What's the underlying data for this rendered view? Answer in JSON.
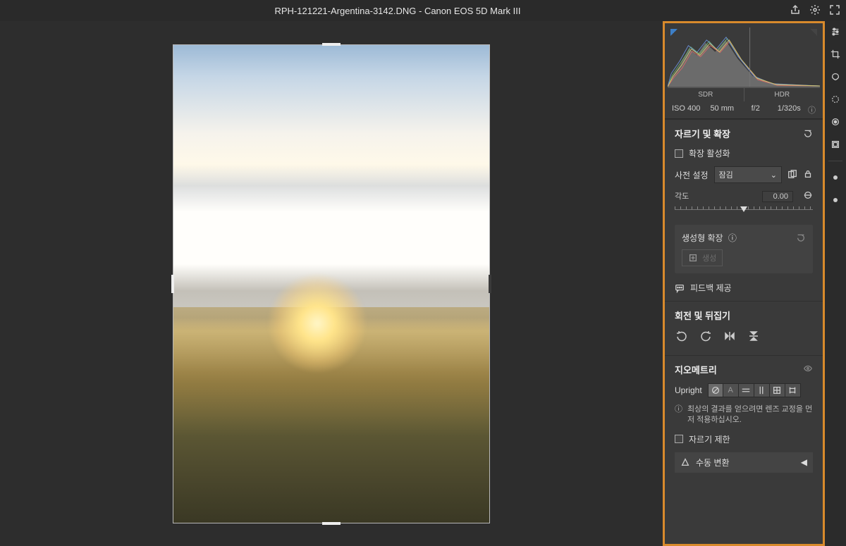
{
  "title": {
    "filename": "RPH-121221-Argentina-3142.DNG",
    "sep": "  -  ",
    "camera": "Canon EOS 5D Mark III"
  },
  "histogram": {
    "sdr": "SDR",
    "hdr": "HDR"
  },
  "meta": {
    "iso": "ISO 400",
    "focal": "50 mm",
    "aperture": "f/2",
    "shutter": "1/320s"
  },
  "crop": {
    "heading": "자르기 및 확장",
    "enable_expand": "확장 활성화",
    "preset_label": "사전 설정",
    "preset_value": "잠김",
    "angle_label": "각도",
    "angle_value": "0.00"
  },
  "gen": {
    "heading": "생성형 확장",
    "button": "생성",
    "feedback": "피드백 제공"
  },
  "rotate": {
    "heading": "회전 및 뒤집기"
  },
  "geometry": {
    "heading": "지오메트리",
    "upright": "Upright",
    "hint": "최상의 결과를 얻으려면 렌즈 교정을 먼저 적용하십시오.",
    "crop_limit": "자르기 제한",
    "manual": "수동 변환"
  }
}
